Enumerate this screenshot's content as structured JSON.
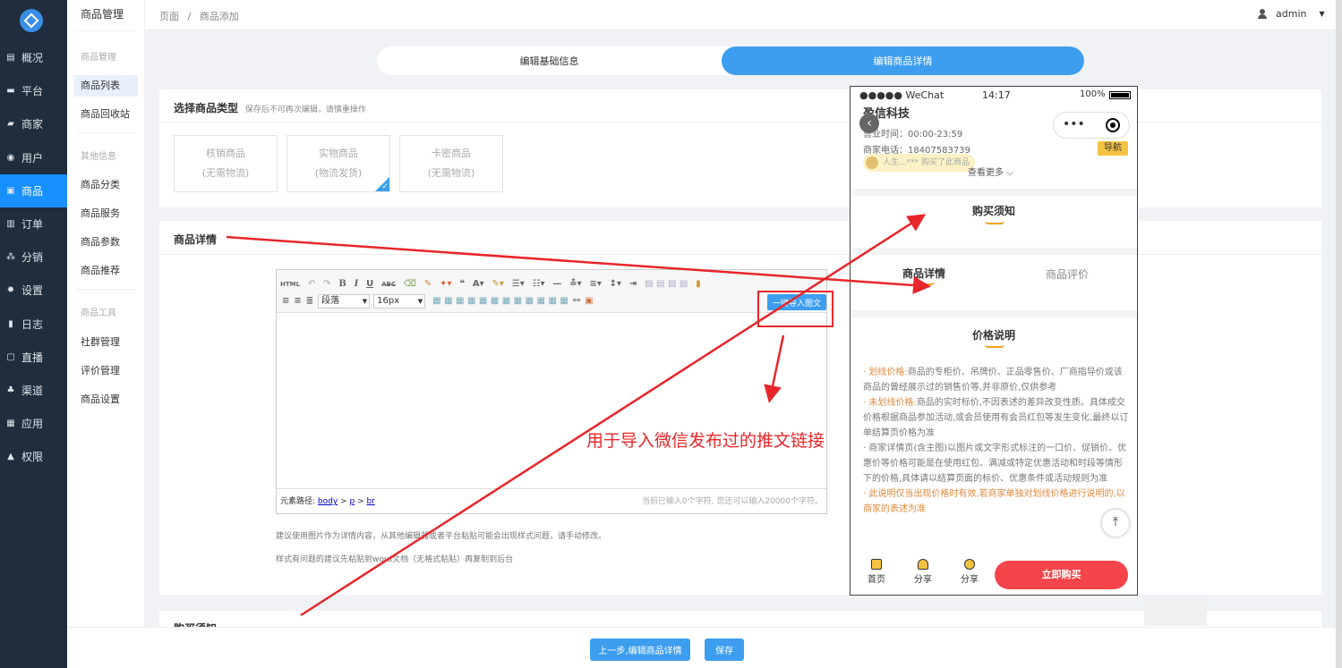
{
  "sidebar": {
    "items": [
      {
        "label": "概况",
        "icon": "gauge-icon"
      },
      {
        "label": "平台",
        "icon": "monitor-icon"
      },
      {
        "label": "商家",
        "icon": "store-icon"
      },
      {
        "label": "用户",
        "icon": "user-icon"
      },
      {
        "label": "商品",
        "icon": "goods-icon"
      },
      {
        "label": "订单",
        "icon": "order-icon"
      },
      {
        "label": "分销",
        "icon": "share-tree-icon"
      },
      {
        "label": "设置",
        "icon": "gear-icon"
      },
      {
        "label": "日志",
        "icon": "book-icon"
      },
      {
        "label": "直播",
        "icon": "live-icon"
      },
      {
        "label": "渠道",
        "icon": "channel-icon"
      },
      {
        "label": "应用",
        "icon": "grid-icon"
      },
      {
        "label": "权限",
        "icon": "lock-icon"
      }
    ]
  },
  "subnav": {
    "title": "商品管理",
    "group1": "商品管理",
    "list": "商品列表",
    "recycle": "商品回收站",
    "group2": "其他信息",
    "cat": "商品分类",
    "service": "商品服务",
    "params": "商品参数",
    "recommend": "商品推荐",
    "group3": "商品工具",
    "community": "社群管理",
    "comment": "评价管理",
    "settings": "商品设置"
  },
  "topbar": {
    "crumb1": "页面",
    "sep": "/",
    "crumb2": "商品添加",
    "user": "admin"
  },
  "steps": {
    "basic": "编辑基础信息",
    "detail": "编辑商品详情"
  },
  "type": {
    "title": "选择商品类型",
    "hint": "保存后不可再次编辑，请慎重操作",
    "options": [
      {
        "name": "核销商品",
        "sub": "(无需物流)"
      },
      {
        "name": "实物商品",
        "sub": "(物流发货)"
      },
      {
        "name": "卡密商品",
        "sub": "(无需物流)"
      }
    ]
  },
  "detail": {
    "title": "商品详情",
    "para": "段落",
    "size": "16px",
    "import": "一键导入图文",
    "path_label": "元素路径:",
    "path_body": "body",
    "path_p": "p",
    "path_br": "br",
    "counter": "当前已输入0个字符, 您还可以输入20000个字符。",
    "note1": "建议使用图片作为详情内容，从其他编辑器或者平台粘贴可能会出现样式问题，请手动修改。",
    "note2": "样式有问题的建议先粘贴到word文档（无格式粘贴）再复制到后台"
  },
  "purchase_title": "购买须知",
  "annotation": "用于导入微信发布过的推文链接",
  "footer": {
    "prev": "上一步,编辑商品详情",
    "save": "保存"
  },
  "phone": {
    "carrier": "●●●●● WeChat",
    "time": "14:17",
    "battery": "100%",
    "shop": "盈信科技",
    "hours": "营业时间：00:00-23:59",
    "tel": "商家电话：18407583739",
    "buyer": "人生...*** 购买了此商品",
    "more": "查看更多",
    "nav": "导航",
    "sec_purchase": "购买须知",
    "tab_detail": "商品详情",
    "tab_review": "商品评价",
    "sec_price": "价格说明",
    "p1a": "· 划线价格:",
    "p1b": "商品的专柜价、吊牌价、正品零售价、厂商指导价或该商品的曾经展示过的销售价等,并非原价,仅供参考",
    "p2a": "· 未划线价格:",
    "p2b": "商品的实时标价,不因表述的差异改变性质。具体成交价格根据商品参加活动,或会员使用有会员红包等发生变化,最终以订单结算页价格为准",
    "p3": "· 商家详情页(含主图)以图片或文字形式标注的一口价、促销价、优惠价等价格可能是在使用红包、满减或特定优惠活动和时段等情形下的价格,具体请以结算页面的标价、优惠条件或活动规则为准",
    "p4": "· 此说明仅当出现价格时有效,若商家单独对划线价格进行说明的,以商家的表述为准",
    "home": "首页",
    "share1": "分享",
    "share2": "分享",
    "buy": "立即购买"
  },
  "colors": {
    "accent": "#1890ff",
    "step": "#3d9ef0",
    "red": "#e8262a",
    "buy": "#f5454a",
    "orange": "#e08a3c"
  }
}
